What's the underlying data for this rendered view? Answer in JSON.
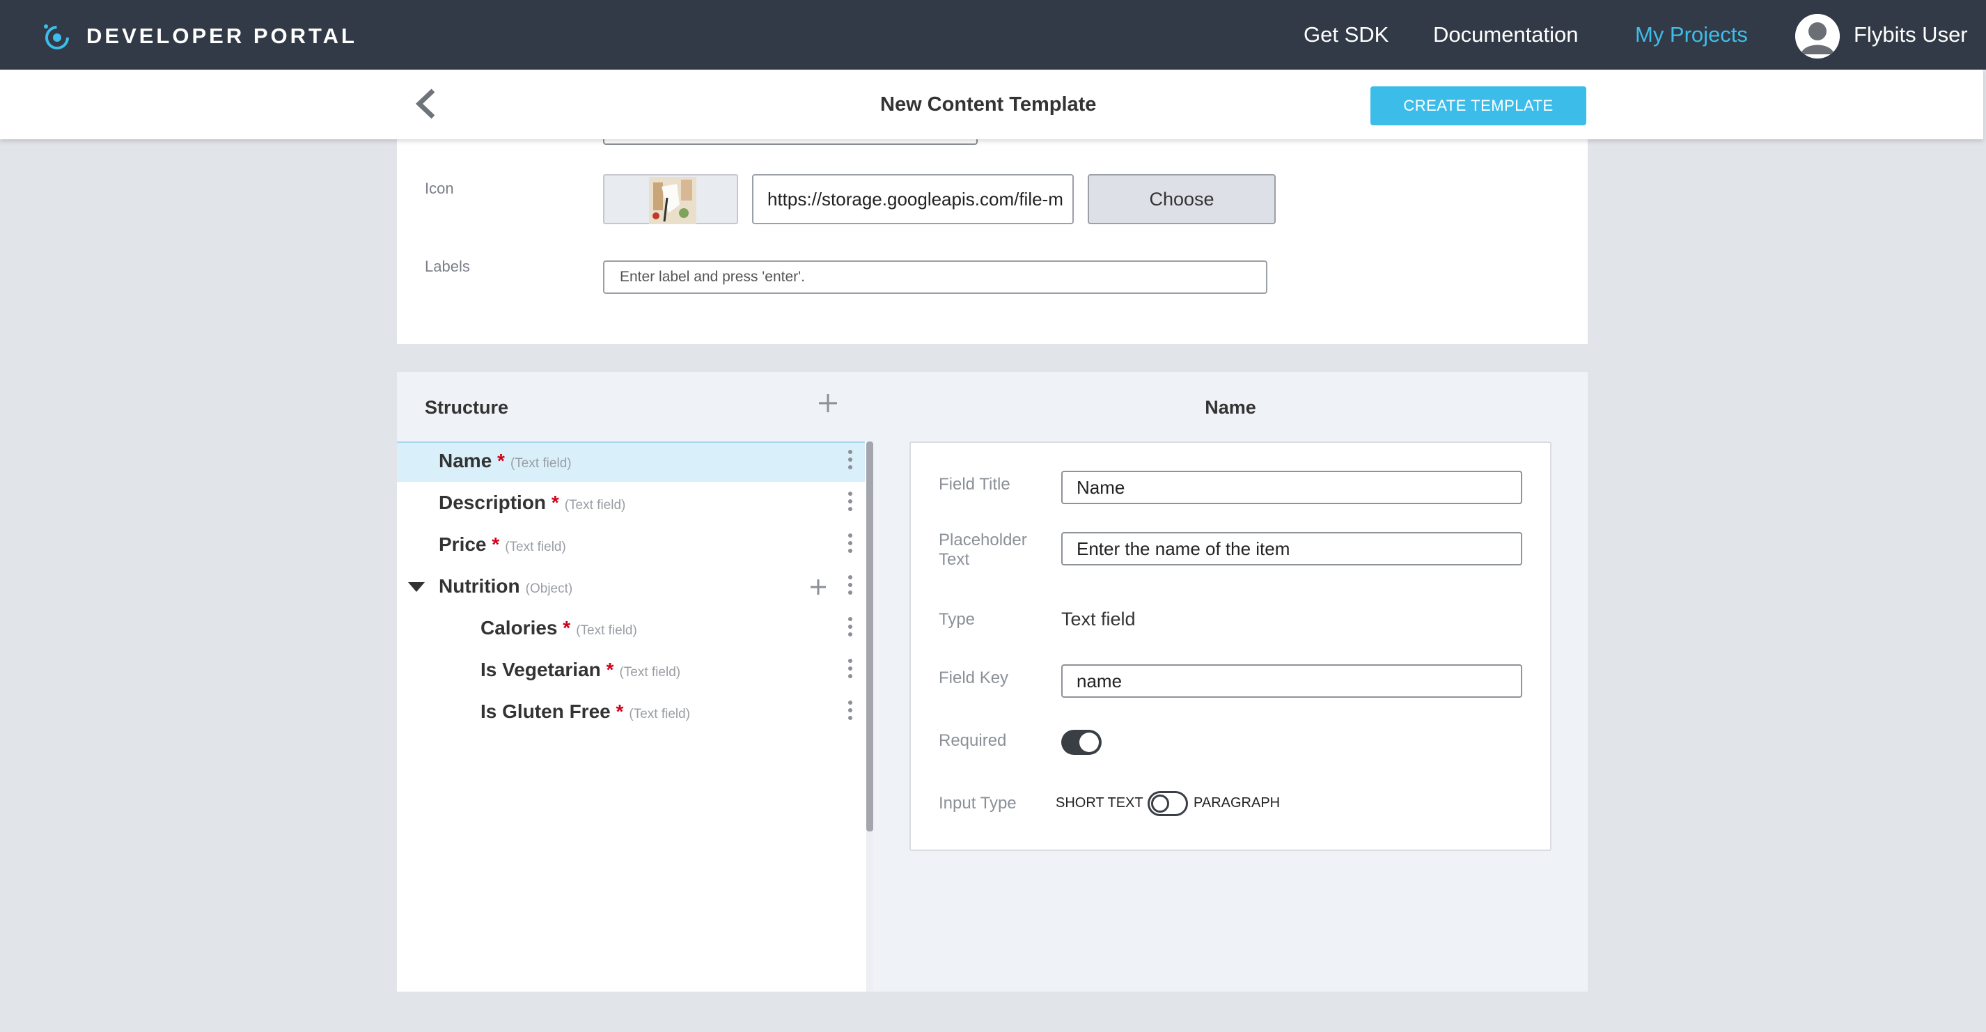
{
  "nav": {
    "brand": "DEVELOPER PORTAL",
    "links": [
      "Get SDK",
      "Documentation",
      "My Projects"
    ],
    "active_link": "My Projects",
    "user_name": "Flybits User",
    "accent_color": "#3fbdea",
    "bg_color": "#313a46"
  },
  "header": {
    "title": "New Content Template",
    "create_label": "CREATE TEMPLATE",
    "back_icon": "chevron-left-icon"
  },
  "form": {
    "icon_label": "Icon",
    "icon_url": "https://storage.googleapis.com/file-m",
    "choose_label": "Choose",
    "labels_label": "Labels",
    "labels_placeholder": "Enter label and press 'enter'."
  },
  "structure": {
    "title": "Structure",
    "add_icon": "plus-icon",
    "items": [
      {
        "name": "Name",
        "required": true,
        "type": "(Text field)",
        "selected": true
      },
      {
        "name": "Description",
        "required": true,
        "type": "(Text field)"
      },
      {
        "name": "Price",
        "required": true,
        "type": "(Text field)"
      },
      {
        "name": "Nutrition",
        "required": false,
        "type": "(Object)",
        "expanded": true
      },
      {
        "name": "Calories",
        "required": true,
        "type": "(Text field)"
      },
      {
        "name": "Is Vegetarian",
        "required": true,
        "type": "(Text field)"
      },
      {
        "name": "Is Gluten Free",
        "required": true,
        "type": "(Text field)"
      }
    ]
  },
  "editor": {
    "title": "Name",
    "field_title_label": "Field Title",
    "field_title_value": "Name",
    "placeholder_label_1": "Placeholder",
    "placeholder_label_2": "Text",
    "placeholder_value": "Enter the name of the item",
    "type_label": "Type",
    "type_value": "Text field",
    "field_key_label": "Field Key",
    "field_key_value": "name",
    "required_label": "Required",
    "required_on": true,
    "input_type_label": "Input Type",
    "input_type_left": "SHORT TEXT",
    "input_type_right": "PARAGRAPH",
    "input_type_paragraph_on": false
  }
}
